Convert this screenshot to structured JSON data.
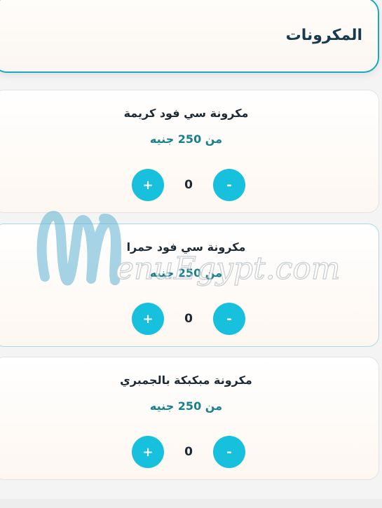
{
  "section": {
    "title": "المكرونات"
  },
  "items": [
    {
      "name": "مكرونة سي فود كريمة",
      "price": "من 250 جنيه",
      "quantity": "0",
      "minus_label": "-",
      "plus_label": "+"
    },
    {
      "name": "مكرونة سي فود حمرا",
      "price": "من 250 جنيه",
      "quantity": "0",
      "minus_label": "-",
      "plus_label": "+"
    },
    {
      "name": "مكرونة مبكبكة بالجمبري",
      "price": "من 250 جنيه",
      "quantity": "0",
      "minus_label": "-",
      "plus_label": "+"
    }
  ],
  "watermark": {
    "text": "enuEgypt.com"
  },
  "colors": {
    "accent": "#17c0dc",
    "title": "#173b4d",
    "price": "#17808f",
    "border": "#14aac0"
  }
}
